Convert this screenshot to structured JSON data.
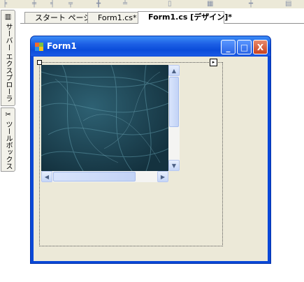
{
  "toolbar": {
    "icons": [
      "align-left-icon",
      "align-center-icon",
      "align-right-icon",
      "align-top-icon",
      "align-middle-icon",
      "align-bottom-icon",
      "size-icon",
      "grid-icon",
      "spacing-icon",
      "order-icon"
    ]
  },
  "sidebar": {
    "tabs": [
      {
        "label": "サーバー エクスプローラ",
        "icon": "server-explorer-icon"
      },
      {
        "label": "ツールボックス",
        "icon": "toolbox-icon"
      }
    ]
  },
  "tabs": {
    "start": "スタート ページ",
    "code": "Form1.cs*",
    "design": "Form1.cs [デザイン]*"
  },
  "form": {
    "title": "Form1",
    "buttons": {
      "minimize": "_",
      "maximize": "□",
      "close": "X"
    }
  },
  "colors": {
    "titlebar": "#0b4cda",
    "client": "#ece9d8",
    "image": "#1b3f4e"
  }
}
